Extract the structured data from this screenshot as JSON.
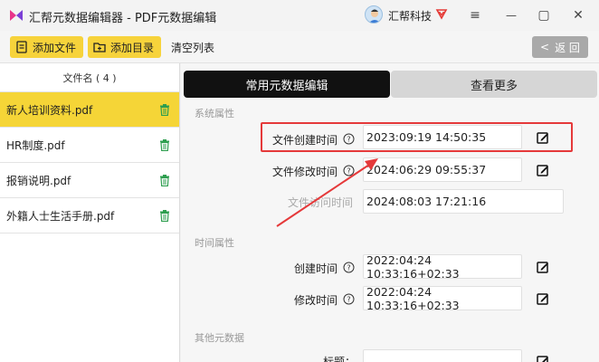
{
  "app": {
    "title": "汇帮元数据编辑器 - PDF元数据编辑",
    "user_name": "汇帮科技"
  },
  "window_controls": {
    "menu": "≡",
    "minimize": "—",
    "maximize": "▢",
    "close": "✕"
  },
  "toolbar": {
    "add_file": "添加文件",
    "add_folder": "添加目录",
    "clear_list": "清空列表",
    "back": "返 回"
  },
  "file_list": {
    "header": "文件名 ( 4 )",
    "items": [
      {
        "name": "新人培训资料.pdf",
        "active": true
      },
      {
        "name": "HR制度.pdf",
        "active": false
      },
      {
        "name": "报销说明.pdf",
        "active": false
      },
      {
        "name": "外籍人士生活手册.pdf",
        "active": false
      }
    ]
  },
  "tabs": {
    "common": "常用元数据编辑",
    "more": "查看更多"
  },
  "sections": {
    "system": "系统属性",
    "time": "时间属性",
    "other": "其他元数据"
  },
  "system_props": {
    "created_label": "文件创建时间",
    "created_value": "2023:09:19 14:50:35",
    "modified_label": "文件修改时间",
    "modified_value": "2024:06:29 09:55:37",
    "accessed_label": "文件访问时间",
    "accessed_value": "2024:08:03 17:21:16"
  },
  "time_props": {
    "create_label": "创建时间",
    "create_value": "2022:04:24 10:33:16+02:33",
    "modify_label": "修改时间",
    "modify_value": "2022:04:24 10:33:16+02:33"
  },
  "other_props": {
    "title_label": "标题："
  },
  "colors": {
    "accent_yellow": "#f5d537",
    "highlight_red": "#e5393a",
    "tab_active": "#111111"
  }
}
